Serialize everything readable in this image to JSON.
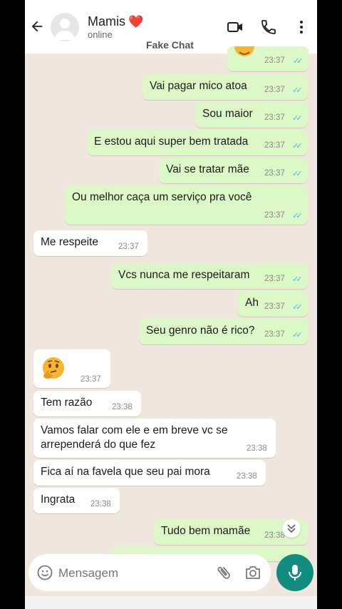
{
  "header": {
    "contact_name": "Mamis",
    "heart": "❤️",
    "status": "online",
    "watermark": "Fake Chat"
  },
  "messages": [
    {
      "dir": "out",
      "text": "Vai pagar mico atoa",
      "time": "23:37"
    },
    {
      "dir": "out",
      "text": "Sou maior",
      "time": "23:37"
    },
    {
      "dir": "out",
      "text": "E estou aqui super bem tratada",
      "time": "23:37"
    },
    {
      "dir": "out",
      "text": "Vai se tratar mãe",
      "time": "23:37"
    },
    {
      "dir": "out",
      "text": "Ou melhor caça um serviço pra você",
      "time": "23:37"
    },
    {
      "dir": "in",
      "text": "Me respeite",
      "time": "23:37"
    },
    {
      "dir": "out",
      "text": "Vcs nunca me respeitaram",
      "time": "23:37"
    },
    {
      "dir": "out",
      "text": "Ah",
      "time": "23:37"
    },
    {
      "dir": "out",
      "text": "Seu genro não é rico?",
      "time": "23:37"
    },
    {
      "dir": "in",
      "text": "thinking-face-emoji",
      "time": "23:37"
    },
    {
      "dir": "in",
      "text": "Tem razão",
      "time": "23:38"
    },
    {
      "dir": "in",
      "text_line1": "Vamos falar com ele e em breve vc se",
      "text_line2": "arrependerá do que fez",
      "time": "23:38"
    },
    {
      "dir": "in",
      "text": "Fica aí na favela que seu pai mora",
      "time": "23:38"
    },
    {
      "dir": "in",
      "text": "Ingrata",
      "time": "23:38"
    },
    {
      "dir": "out",
      "text": "Tudo bem mamãe",
      "time": "23:38"
    }
  ],
  "top_partial_time": "23:37",
  "input": {
    "placeholder": "Mensagem"
  },
  "colors": {
    "outgoing": "#dcf8c6",
    "incoming": "#ffffff",
    "accent": "#128c7e",
    "ticks": "#4fb6ec",
    "background": "#efe7de"
  }
}
